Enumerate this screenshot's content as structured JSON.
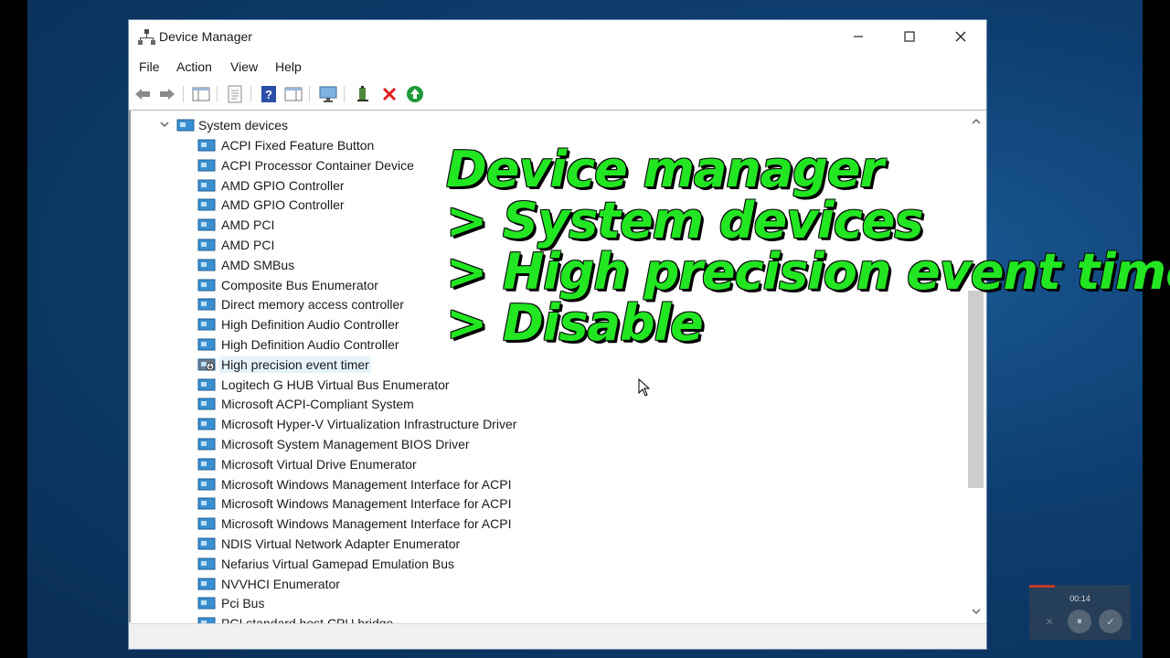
{
  "window": {
    "title": "Device Manager",
    "controls": {
      "minimize": "—",
      "maximize": "☐",
      "close": "✕"
    }
  },
  "menu": [
    "File",
    "Action",
    "View",
    "Help"
  ],
  "toolbar_icons": [
    "back-arrow-icon",
    "forward-arrow-icon",
    "show-hide-console-tree-icon",
    "properties-icon",
    "help-icon",
    "view-icon",
    "monitor-icon",
    "update-driver-icon",
    "uninstall-device-icon",
    "enable-device-icon"
  ],
  "tree": {
    "parent": "System devices",
    "devices": [
      "ACPI Fixed Feature Button",
      "ACPI Processor Container Device",
      "AMD GPIO Controller",
      "AMD GPIO Controller",
      "AMD PCI",
      "AMD PCI",
      "AMD SMBus",
      "Composite Bus Enumerator",
      "Direct memory access controller",
      "High Definition Audio Controller",
      "High Definition Audio Controller",
      "High precision event timer",
      "Logitech G HUB Virtual Bus Enumerator",
      "Microsoft ACPI-Compliant System",
      "Microsoft Hyper-V Virtualization Infrastructure Driver",
      "Microsoft System Management BIOS Driver",
      "Microsoft Virtual Drive Enumerator",
      "Microsoft Windows Management Interface for ACPI",
      "Microsoft Windows Management Interface for ACPI",
      "Microsoft Windows Management Interface for ACPI",
      "NDIS Virtual Network Adapter Enumerator",
      "Nefarius Virtual Gamepad Emulation Bus",
      "NVVHCI Enumerator",
      "Pci Bus",
      "PCI standard host CPU bridge"
    ],
    "selected_index": 11
  },
  "overlay_text": [
    "Device manager",
    "> System devices",
    "> High precision event timer",
    "> Disable"
  ],
  "recorder": {
    "time": "00:14",
    "cancel": "✕",
    "pause": "⏸",
    "done": "✓"
  },
  "colors": {
    "overlay_text": "#22e622",
    "desktop": "#0d3d6e",
    "selection": "#e5f3fb"
  }
}
